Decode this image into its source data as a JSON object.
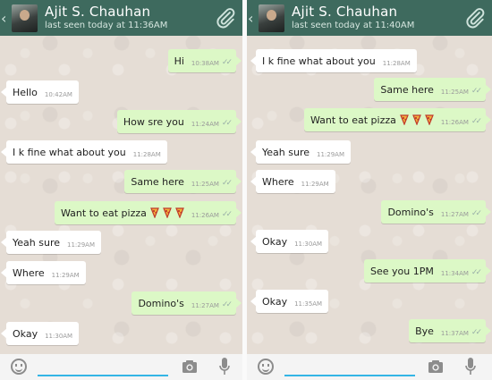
{
  "left_chat": {
    "header": {
      "back": "‹",
      "name": "Ajit S. Chauhan",
      "status": "last seen today at 11:36AM"
    },
    "messages": [
      {
        "dir": "out",
        "text": "Hi",
        "time": "10:38AM"
      },
      {
        "dir": "in",
        "text": "Hello",
        "time": "10:42AM"
      },
      {
        "dir": "out",
        "text": "How sre you",
        "time": "11:24AM"
      },
      {
        "dir": "in",
        "text": "I k fine what about you",
        "time": "11:28AM"
      },
      {
        "dir": "out",
        "text": "Same here",
        "time": "11:25AM"
      },
      {
        "dir": "out",
        "text": "Want to eat pizza",
        "time": "11:26AM",
        "emoji": "pizza-x3"
      },
      {
        "dir": "in",
        "text": "Yeah sure",
        "time": "11:29AM"
      },
      {
        "dir": "in",
        "text": "Where",
        "time": "11:29AM"
      },
      {
        "dir": "out",
        "text": "Domino's",
        "time": "11:27AM"
      },
      {
        "dir": "in",
        "text": "Okay",
        "time": "11:30AM"
      }
    ]
  },
  "right_chat": {
    "header": {
      "back": "‹",
      "name": "Ajit S. Chauhan",
      "status": "last seen today at 11:40AM"
    },
    "messages": [
      {
        "dir": "in",
        "text": "I k fine what about you",
        "time": "11:28AM"
      },
      {
        "dir": "out",
        "text": "Same here",
        "time": "11:25AM"
      },
      {
        "dir": "out",
        "text": "Want to eat pizza",
        "time": "11:26AM",
        "emoji": "pizza-x3"
      },
      {
        "dir": "in",
        "text": "Yeah sure",
        "time": "11:29AM"
      },
      {
        "dir": "in",
        "text": "Where",
        "time": "11:29AM"
      },
      {
        "dir": "out",
        "text": "Domino's",
        "time": "11:27AM"
      },
      {
        "dir": "in",
        "text": "Okay",
        "time": "11:30AM"
      },
      {
        "dir": "out",
        "text": "See you 1PM",
        "time": "11:34AM"
      },
      {
        "dir": "in",
        "text": "Okay",
        "time": "11:35AM"
      },
      {
        "dir": "out",
        "text": "Bye",
        "time": "11:37AM"
      }
    ]
  },
  "icons": {
    "attach": "paperclip-icon",
    "emoji": "smiley-icon",
    "camera": "camera-icon",
    "mic": "microphone-icon",
    "read": "double-check-icon"
  },
  "colors": {
    "header": "#3e6a5e",
    "outgoing": "#dcf8c6",
    "incoming": "#ffffff",
    "wallpaper": "#e5ddd5",
    "input_accent": "#33b5e5"
  }
}
